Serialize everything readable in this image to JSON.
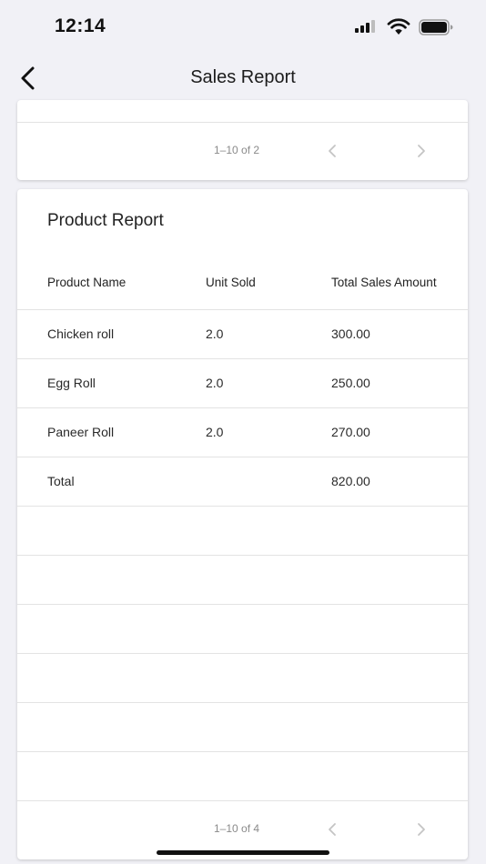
{
  "status_bar": {
    "time": "12:14"
  },
  "header": {
    "title": "Sales Report",
    "back_icon": "chevron-left-icon"
  },
  "top_card": {
    "pagination": {
      "range": "1–10 of 2",
      "prev_icon": "chevron-left-icon",
      "next_icon": "chevron-right-icon"
    }
  },
  "product_report": {
    "title": "Product Report",
    "columns": {
      "product_name": "Product Name",
      "unit_sold": "Unit Sold",
      "total_sales_amount": "Total Sales Amount"
    },
    "rows": [
      {
        "product": "Chicken roll",
        "units": "2.0",
        "amount": "300.00"
      },
      {
        "product": "Egg Roll",
        "units": "2.0",
        "amount": "250.00"
      },
      {
        "product": "Paneer Roll",
        "units": "2.0",
        "amount": "270.00"
      },
      {
        "product": "Total",
        "units": "",
        "amount": "820.00"
      }
    ],
    "pagination": {
      "range": "1–10 of 4",
      "prev_icon": "chevron-left-icon",
      "next_icon": "chevron-right-icon"
    }
  },
  "colors": {
    "background": "#f1f1f6",
    "card": "#ffffff",
    "divider": "#e3e3e3",
    "disabled_chevron": "#c4c4c4"
  }
}
